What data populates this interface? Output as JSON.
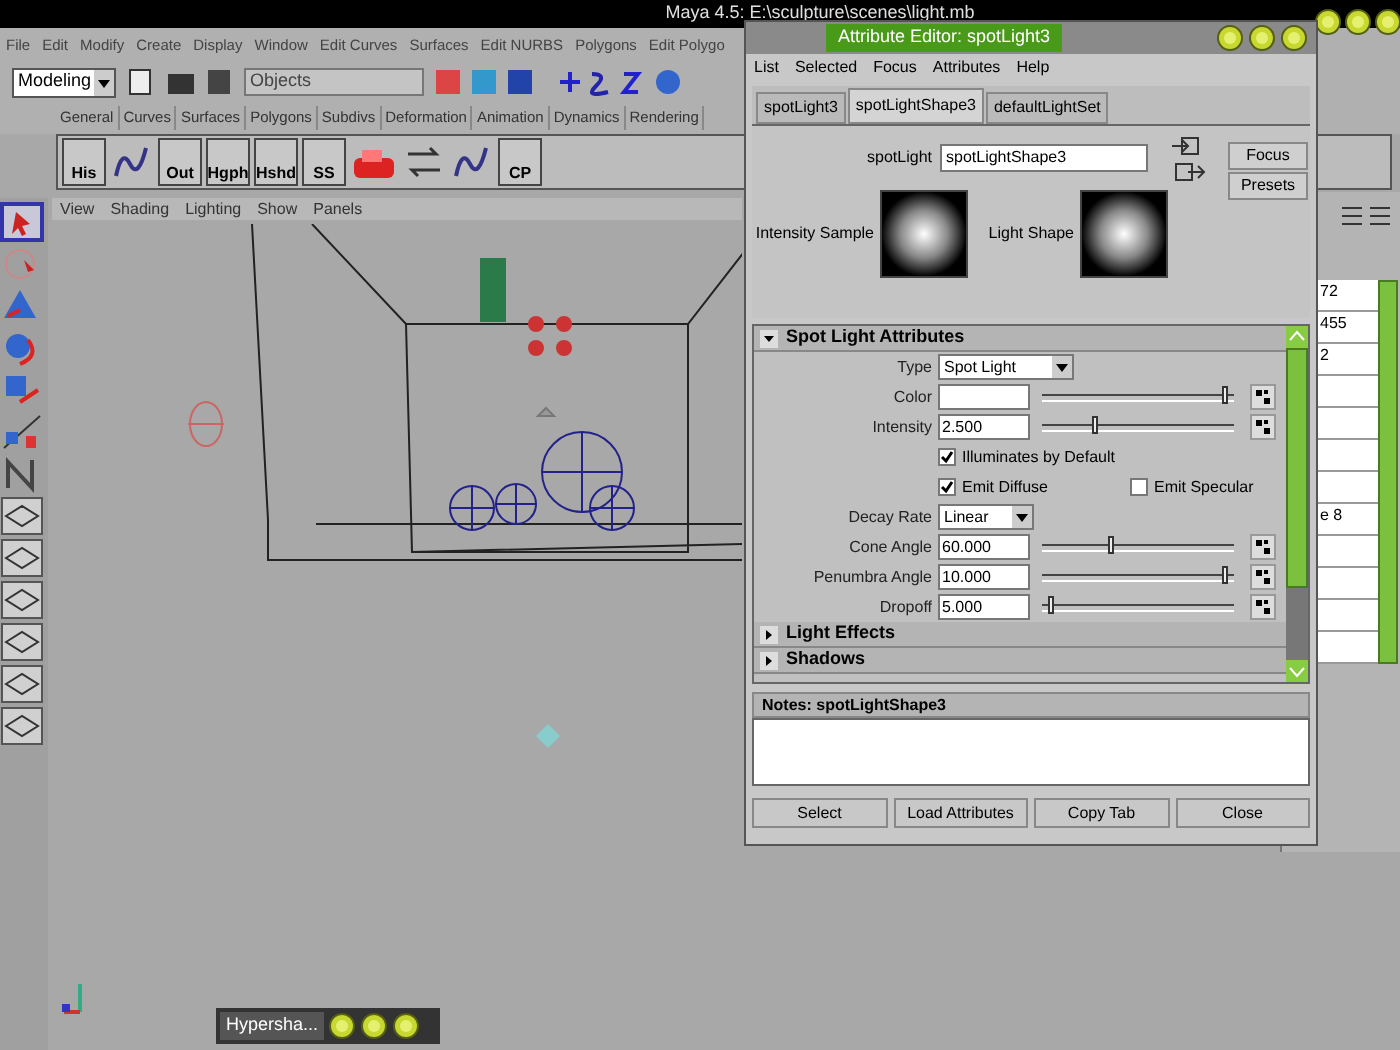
{
  "main_window": {
    "title": "Maya 4.5: E:\\sculpture\\scenes\\light.mb"
  },
  "menu_bar": [
    "File",
    "Edit",
    "Modify",
    "Create",
    "Display",
    "Window",
    "Edit Curves",
    "Surfaces",
    "Edit NURBS",
    "Polygons",
    "Edit Polygo"
  ],
  "status_line": {
    "mode": "Modeling",
    "selection_field": "Objects"
  },
  "shelf_tabs": [
    "General",
    "Curves",
    "Surfaces",
    "Polygons",
    "Subdivs",
    "Deformation",
    "Animation",
    "Dynamics",
    "Rendering"
  ],
  "shelf_buttons": [
    {
      "kind": "labeled",
      "label": "His"
    },
    {
      "kind": "curve"
    },
    {
      "kind": "labeled",
      "label": "Out"
    },
    {
      "kind": "labeled",
      "label": "Hgph"
    },
    {
      "kind": "labeled",
      "label": "Hshd"
    },
    {
      "kind": "labeled",
      "label": "SS"
    },
    {
      "kind": "render"
    },
    {
      "kind": "swap"
    },
    {
      "kind": "curve"
    },
    {
      "kind": "labeled",
      "label": "CP"
    }
  ],
  "panel_menu": [
    "View",
    "Shading",
    "Lighting",
    "Show",
    "Panels"
  ],
  "attribute_editor": {
    "title": "Attribute Editor: spotLight3",
    "menu": [
      "List",
      "Selected",
      "Focus",
      "Attributes",
      "Help"
    ],
    "tabs": [
      {
        "label": "spotLight3",
        "selected": false
      },
      {
        "label": "spotLightShape3",
        "selected": true
      },
      {
        "label": "defaultLightSet",
        "selected": false
      }
    ],
    "node_label": "spotLight",
    "node_value": "spotLightShape3",
    "side_buttons": [
      "Focus",
      "Presets"
    ],
    "swatches": [
      "Intensity Sample",
      "Light Shape"
    ],
    "sections": [
      {
        "title": "Spot Light Attributes",
        "expanded": true,
        "fields": [
          {
            "kind": "dropdown",
            "label": "Type",
            "value": "Spot Light"
          },
          {
            "kind": "color",
            "label": "Color",
            "level": 0.97
          },
          {
            "kind": "slider",
            "label": "Intensity",
            "value": "2.500",
            "level": 0.27
          },
          {
            "kind": "checks",
            "items": [
              {
                "label": "Illuminates by Default",
                "checked": true
              }
            ]
          },
          {
            "kind": "checks",
            "items": [
              {
                "label": "Emit Diffuse",
                "checked": true
              },
              {
                "label": "Emit Specular",
                "checked": false
              }
            ]
          },
          {
            "kind": "dropdown",
            "label": "Decay Rate",
            "value": "Linear"
          },
          {
            "kind": "slider",
            "label": "Cone Angle",
            "value": "60.000",
            "level": 0.35
          },
          {
            "kind": "slider",
            "label": "Penumbra Angle",
            "value": "10.000",
            "level": 0.97
          },
          {
            "kind": "slider",
            "label": "Dropoff",
            "value": "5.000",
            "level": 0.03
          }
        ]
      },
      {
        "title": "Light Effects",
        "expanded": false
      },
      {
        "title": "Shadows",
        "expanded": false
      }
    ],
    "notes_title": "Notes: spotLightShape3",
    "buttons": [
      "Select",
      "Load Attributes",
      "Copy Tab",
      "Close"
    ]
  },
  "channel_box": {
    "cells": [
      "72",
      "455",
      "2",
      "",
      "",
      "",
      "",
      "e 8",
      "",
      "",
      "",
      ""
    ]
  },
  "taskbar": {
    "minimized_window": "Hypersha..."
  }
}
